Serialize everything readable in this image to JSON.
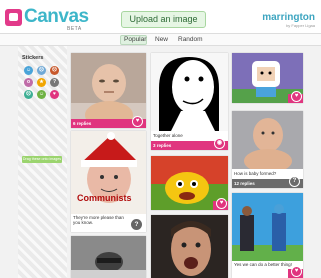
{
  "app": {
    "logo_text": "Canvas",
    "logo_beta": "BETA",
    "upload_label": "Upload an image",
    "user_name": "marrington",
    "user_sub": "by Fapper Ligaa"
  },
  "nav": {
    "tabs": [
      {
        "label": "Popular"
      },
      {
        "label": "New"
      },
      {
        "label": "Random"
      }
    ]
  },
  "sidebar": {
    "title": "Stickers",
    "stickers": [
      {
        "name": "smiley-sticker",
        "color": "#4aa4d9",
        "glyph": "☺"
      },
      {
        "name": "sad-sticker",
        "color": "#6fa9d6",
        "glyph": "☹"
      },
      {
        "name": "angry-sticker",
        "color": "#c8592c",
        "glyph": "☹"
      },
      {
        "name": "wow-sticker",
        "color": "#c06ca8",
        "glyph": "o"
      },
      {
        "name": "star-sticker",
        "color": "#f1a500",
        "glyph": "★"
      },
      {
        "name": "question-sticker",
        "color": "#777777",
        "glyph": "?"
      },
      {
        "name": "cry-sticker",
        "color": "#3daf94",
        "glyph": "☹"
      },
      {
        "name": "lol-sticker",
        "color": "#6fb243",
        "glyph": "☺"
      },
      {
        "name": "heart-sticker",
        "color": "#e0357f",
        "glyph": "♥"
      }
    ],
    "drag_tip": "Drag these onto images"
  },
  "posts": [
    {
      "caption": "",
      "replies": "6 replies",
      "sticker": "♥",
      "bar": "pink"
    },
    {
      "caption": "They're more please than you know.",
      "replies": "",
      "sticker": "?",
      "bar": "none",
      "overlay_text": "Communists"
    },
    {
      "caption": "Together alone",
      "replies": "3 replies",
      "sticker": "◉",
      "bar": "pink"
    },
    {
      "caption": "",
      "replies": "5 replies",
      "sticker": "♥",
      "bar": "pink"
    },
    {
      "caption": "",
      "replies": "",
      "sticker": "",
      "bar": "none"
    },
    {
      "caption": "",
      "replies": "",
      "sticker": "",
      "bar": "none"
    },
    {
      "caption": "",
      "replies": "",
      "sticker": "♥",
      "bar": "pink"
    },
    {
      "caption": "How is baby formed?",
      "replies": "12 replies",
      "sticker": "?",
      "bar": "gray"
    },
    {
      "caption": "Yes we can do a better thing!",
      "replies": "",
      "sticker": "♥",
      "bar": "pink"
    }
  ]
}
